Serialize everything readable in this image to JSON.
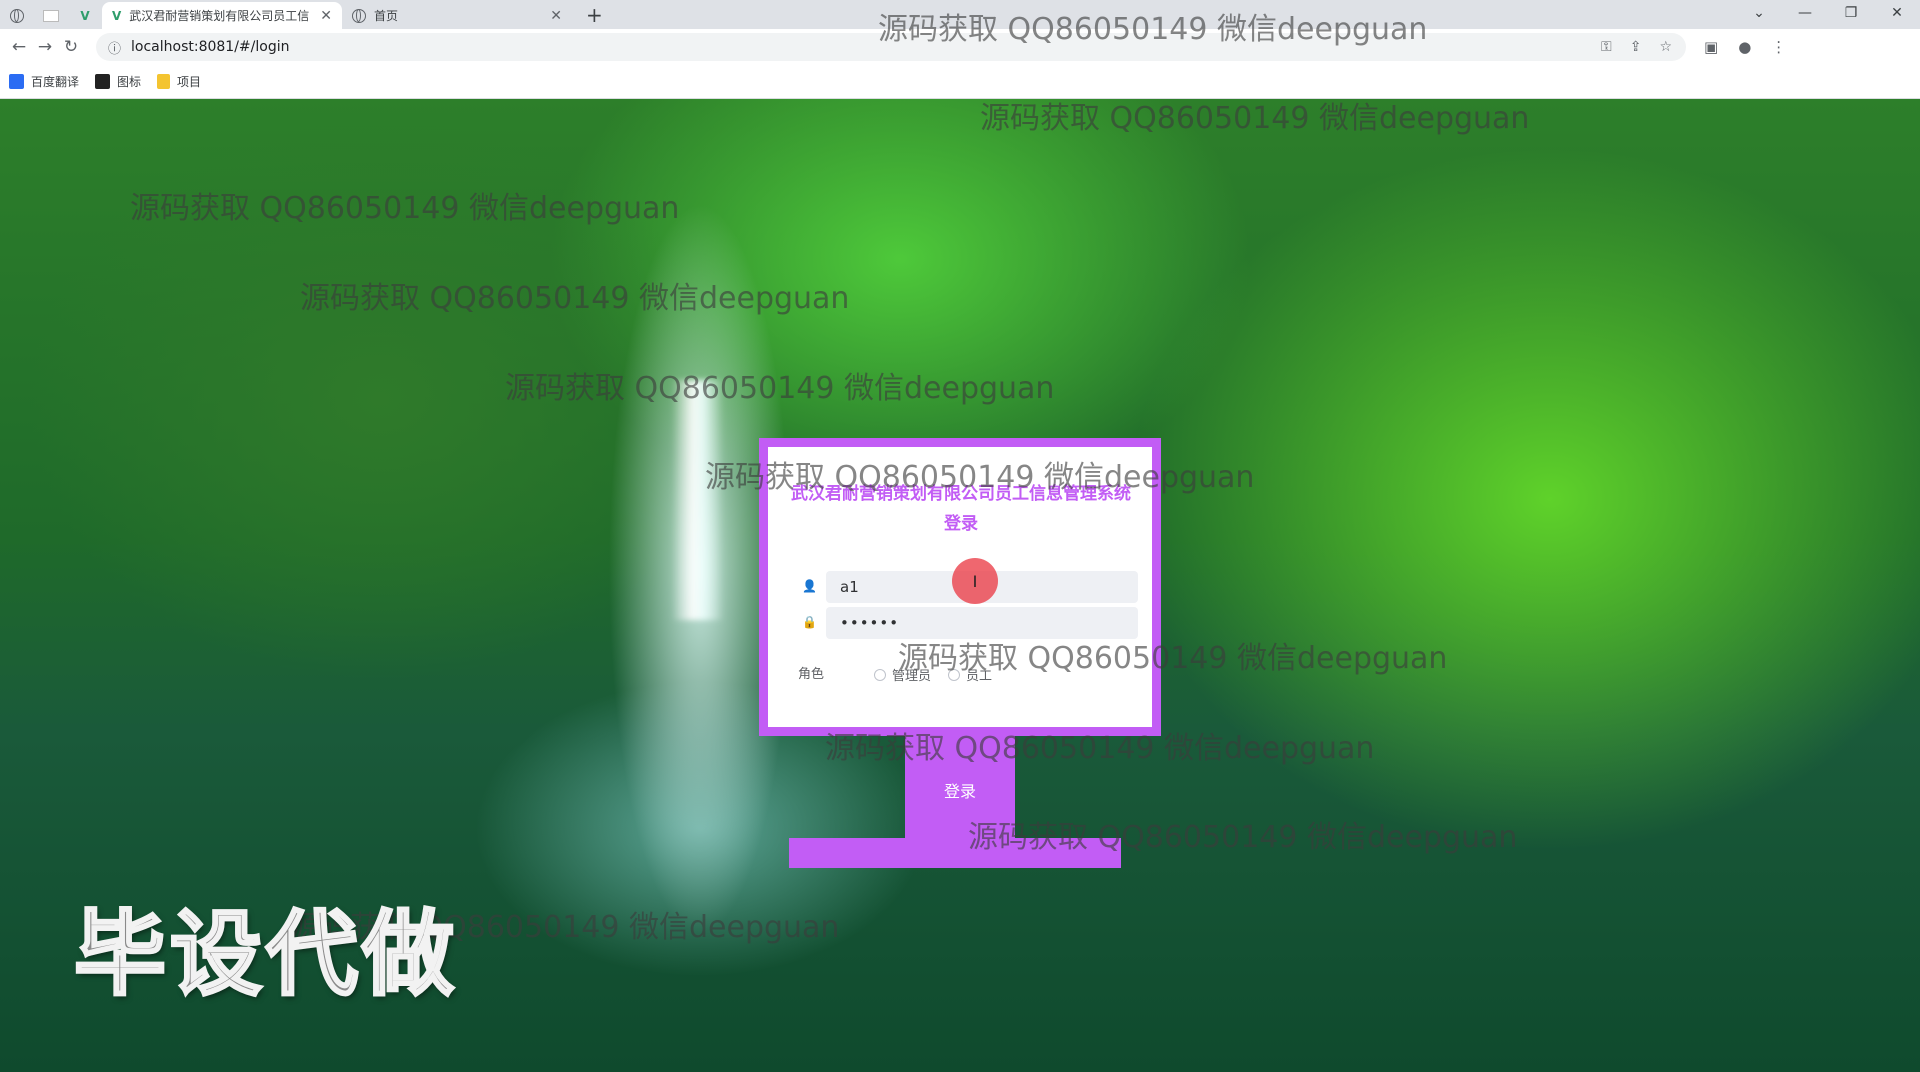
{
  "browser": {
    "tabs": [
      {
        "title": "武汉君耐营销策划有限公司员工信",
        "active": true
      },
      {
        "title": "首页",
        "active": false
      }
    ],
    "address": "localhost:8081/#/login",
    "bookmarks": [
      {
        "label": "百度翻译",
        "color": "#2b6cf3"
      },
      {
        "label": "图标",
        "color": "#222222"
      },
      {
        "label": "项目",
        "color": "#f4c430"
      }
    ]
  },
  "login": {
    "title": "武汉君耐营销策划有限公司员工信息管理系统登录",
    "username_value": "a1",
    "password_value": "••••••",
    "role_label": "角色",
    "roles": [
      "管理员",
      "员工"
    ],
    "submit_label": "登录"
  },
  "watermarks": [
    "源码获取 QQ86050149 微信deepguan",
    "源码获取 QQ86050149 微信deepguan",
    "源码获取 QQ86050149 微信deepguan",
    "源码获取 QQ86050149 微信deepguan",
    "源码获取 QQ86050149 微信deepguan",
    "源码获取 QQ86050149 微信deepguan",
    "源码获取 QQ86050149 微信deepguan",
    "源码获取 QQ86050149 微信deepguan",
    "源码获取 QQ86050149 微信deepguan",
    "源码获取 QQ86050149 微信deepguan"
  ],
  "stamp": "毕设代做",
  "colors": {
    "accent": "#c25df5"
  }
}
